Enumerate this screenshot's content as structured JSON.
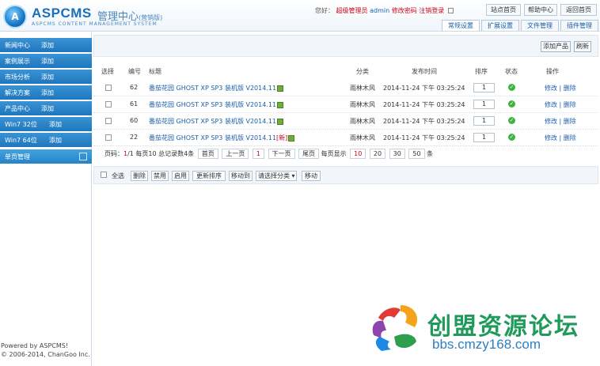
{
  "header": {
    "logo_letter": "A",
    "brand": "ASPCMS",
    "brand_cn": "管理中心",
    "brand_cn_small": "(营销版)",
    "brand_sub": "ASPCMS CONTENT MANAGEMENT SYSTEM",
    "greeting": "您好：",
    "role": "超级管理员",
    "user": "admin",
    "change_password": "修改密码",
    "logout": "注销登录",
    "buttons": [
      "站点首页",
      "帮助中心",
      "返回首页"
    ],
    "tabs": [
      "常规设置",
      "扩展设置",
      "文件管理",
      "插件管理"
    ]
  },
  "sidebar": {
    "items": [
      {
        "label": "新闻中心",
        "action": "添加"
      },
      {
        "label": "案例展示",
        "action": "添加"
      },
      {
        "label": "市场分析",
        "action": "添加"
      },
      {
        "label": "解决方案",
        "action": "添加"
      },
      {
        "label": "产品中心",
        "action": "添加"
      },
      {
        "label": "Win7 32位",
        "action": "添加"
      },
      {
        "label": "Win7 64位",
        "action": "添加"
      },
      {
        "label": "单页管理",
        "action": ""
      }
    ],
    "footer_line1": "Powered by ASPCMS!",
    "footer_line2": "© 2006-2014, ChanGoo Inc."
  },
  "toolbar": {
    "add_label": "添加产品",
    "refresh_label": "刷新"
  },
  "table": {
    "headers": [
      "选择",
      "编号",
      "标题",
      "分类",
      "发布时间",
      "排序",
      "状态",
      "操作"
    ],
    "rows": [
      {
        "id": "62",
        "title": "番茄花园 GHOST XP SP3 装机版 V2014.11",
        "category": "雨林木风",
        "date": "2014-11-24 下午 03:25:24",
        "order": "1",
        "action": "修改 | 删除",
        "tag": ""
      },
      {
        "id": "61",
        "title": "番茄花园 GHOST XP SP3 装机版 V2014.11",
        "category": "雨林木风",
        "date": "2014-11-24 下午 03:25:24",
        "order": "1",
        "action": "修改 | 删除",
        "tag": ""
      },
      {
        "id": "60",
        "title": "番茄花园 GHOST XP SP3 装机版 V2014.11",
        "category": "雨林木风",
        "date": "2014-11-24 下午 03:25:24",
        "order": "1",
        "action": "修改 | 删除",
        "tag": ""
      },
      {
        "id": "22",
        "title": "番茄花园 GHOST XP SP3 装机版 V2014.11",
        "category": "雨林木风",
        "date": "2014-11-24 下午 03:25:24",
        "order": "1",
        "action": "修改 | 删除",
        "tag": "[新]"
      }
    ]
  },
  "pager": {
    "summary_prefix": "页码：",
    "current": "1",
    "summary_rest": "/1 每页10 总记录数4条",
    "first": "首页",
    "prev": "上一页",
    "page": "1",
    "next": "下一页",
    "last": "尾页",
    "per_page_label": "每页显示",
    "sizes": [
      "10",
      "20",
      "30",
      "50"
    ],
    "unit": "条"
  },
  "bottombar": {
    "select_all": "全选",
    "buttons": [
      "删除",
      "禁用",
      "启用",
      "更新排序",
      "移动到"
    ],
    "select_value": "请选择分类",
    "move_button": "移动"
  },
  "watermark": {
    "text": "创盟资源论坛",
    "url": "bbs.cmzy168.com"
  },
  "colors": {
    "accent": "#1f76bd",
    "status_ok": "#3fb33f",
    "alert": "#d0021b"
  }
}
